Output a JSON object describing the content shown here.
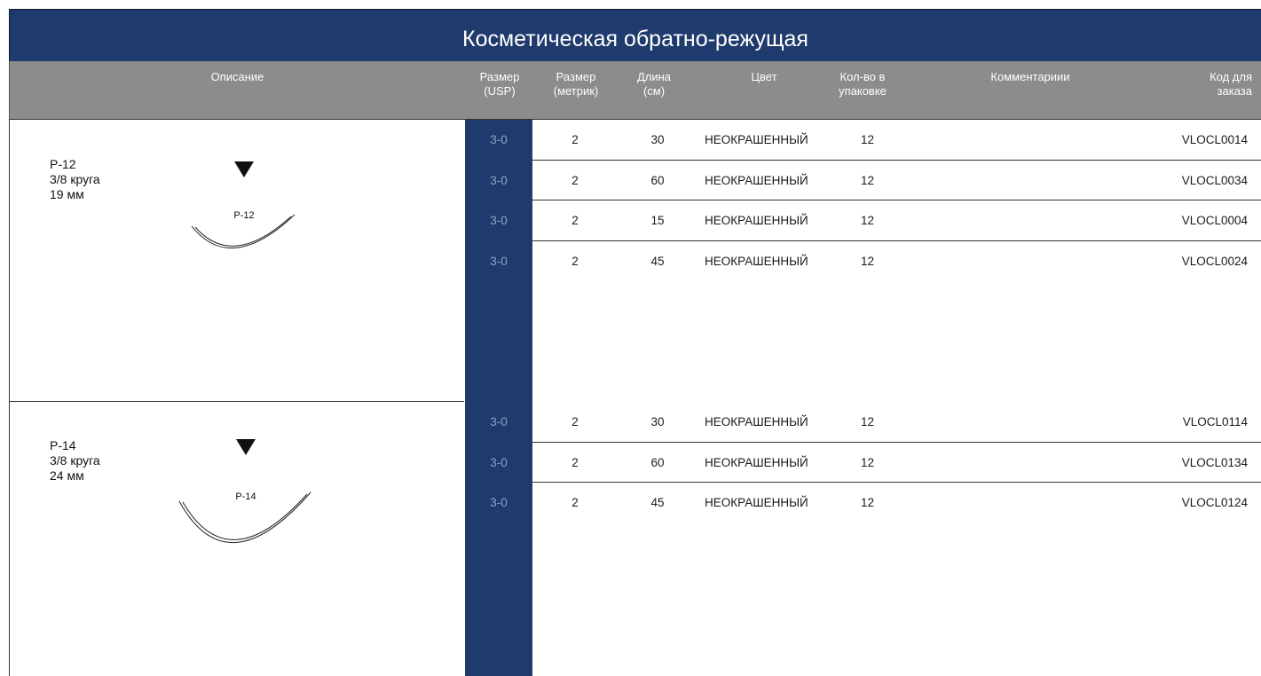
{
  "title": "Косметическая обратно-режущая",
  "headers": {
    "description": "Описание",
    "size_usp": [
      "Размер",
      "(USP)"
    ],
    "size_metric": [
      "Размер",
      "(метрик)"
    ],
    "length": [
      "Длина",
      "(см)"
    ],
    "color": "Цвет",
    "qty": [
      "Кол-во в",
      "упаковке"
    ],
    "comments": "Комментариии",
    "order_code": [
      "Код для",
      "заказа"
    ]
  },
  "groups": [
    {
      "needle": "P-12",
      "arc": "3/8 круга",
      "length": "19 мм",
      "rows": [
        {
          "usp": "3-0",
          "metric": "2",
          "length": "30",
          "color": "НЕОКРАШЕННЫЙ",
          "qty": "12",
          "code": "VLOCL0014"
        },
        {
          "usp": "3-0",
          "metric": "2",
          "length": "60",
          "color": "НЕОКРАШЕННЫЙ",
          "qty": "12",
          "code": "VLOCL0034"
        },
        {
          "usp": "3-0",
          "metric": "2",
          "length": "15",
          "color": "НЕОКРАШЕННЫЙ",
          "qty": "12",
          "code": "VLOCL0004"
        },
        {
          "usp": "3-0",
          "metric": "2",
          "length": "45",
          "color": "НЕОКРАШЕННЫЙ",
          "qty": "12",
          "code": "VLOCL0024"
        }
      ]
    },
    {
      "needle": "P-14",
      "arc": "3/8 круга",
      "length": "24 мм",
      "rows": [
        {
          "usp": "3-0",
          "metric": "2",
          "length": "30",
          "color": "НЕОКРАШЕННЫЙ",
          "qty": "12",
          "code": "VLOCL0114"
        },
        {
          "usp": "3-0",
          "metric": "2",
          "length": "60",
          "color": "НЕОКРАШЕННЫЙ",
          "qty": "12",
          "code": "VLOCL0134"
        },
        {
          "usp": "3-0",
          "metric": "2",
          "length": "45",
          "color": "НЕОКРАШЕННЫЙ",
          "qty": "12",
          "code": "VLOCL0124"
        }
      ]
    }
  ],
  "colors": {
    "navy": "#1f3a6c",
    "header_gray": "#8c8c8c",
    "usp_text": "#8ea2c6"
  },
  "icons": [
    "triangle-down-icon",
    "needle-curve-icon"
  ]
}
